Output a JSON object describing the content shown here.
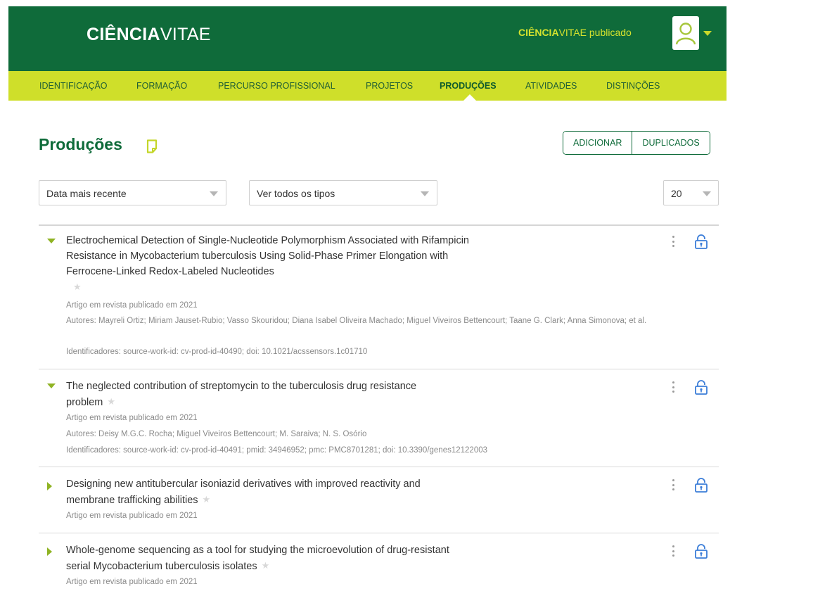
{
  "header": {
    "logo_bold": "CIÊNCIA",
    "logo_light": "VITAE",
    "status_bold": "CIÊNCIA",
    "status_rest": "VITAE publicado"
  },
  "nav": {
    "items": [
      {
        "label": "IDENTIFICAÇÃO"
      },
      {
        "label": "FORMAÇÃO"
      },
      {
        "label": "PERCURSO PROFISSIONAL"
      },
      {
        "label": "PROJETOS"
      },
      {
        "label": "PRODUÇÕES"
      },
      {
        "label": "ATIVIDADES"
      },
      {
        "label": "DISTINÇÕES"
      }
    ],
    "active": "PRODUÇÕES"
  },
  "page": {
    "title": "Produções",
    "add_label": "ADICIONAR",
    "duplicates_label": "DUPLICADOS"
  },
  "filters": {
    "sort": "Data mais recente",
    "type": "Ver todos os tipos",
    "page_size": "20"
  },
  "productions": [
    {
      "title": "Electrochemical Detection of Single-Nucleotide Polymorphism Associated with Rifampicin Resistance in Mycobacterium tuberculosis Using Solid-Phase Primer Elongation with Ferrocene-Linked Redox-Labeled Nucleotides",
      "type": "Artigo em revista publicado em 2021",
      "authors": "Autores: Mayreli Ortiz; Miriam Jauset-Rubio; Vasso Skouridou; Diana Isabel Oliveira Machado; Miguel Viveiros Bettencourt; Taane G. Clark; Anna Simonova; et al.",
      "identifiers": "Identificadores: source-work-id: cv-prod-id-40490; doi: 10.1021/acssensors.1c01710",
      "expanded": true
    },
    {
      "title": "The neglected contribution of streptomycin to the tuberculosis drug resistance problem",
      "type": "Artigo em revista publicado em 2021",
      "authors": "Autores: Deisy M.G.C. Rocha; Miguel Viveiros Bettencourt; M. Saraiva; N. S. Osório",
      "identifiers": "Identificadores: source-work-id: cv-prod-id-40491; pmid: 34946952; pmc: PMC8701281; doi: 10.3390/genes12122003",
      "expanded": true
    },
    {
      "title": "Designing new antitubercular isoniazid derivatives with improved reactivity and membrane trafficking abilities",
      "type": "Artigo em revista publicado em 2021",
      "expanded": false
    },
    {
      "title": "Whole-genome sequencing as a tool for studying the microevolution of drug-resistant serial Mycobacterium tuberculosis isolates",
      "type": "Artigo em revista publicado em 2021",
      "expanded": false
    }
  ],
  "colors": {
    "header_green": "#0f6b3a",
    "nav_lime": "#cfdf2a",
    "accent_blue": "#3b7dd8"
  }
}
